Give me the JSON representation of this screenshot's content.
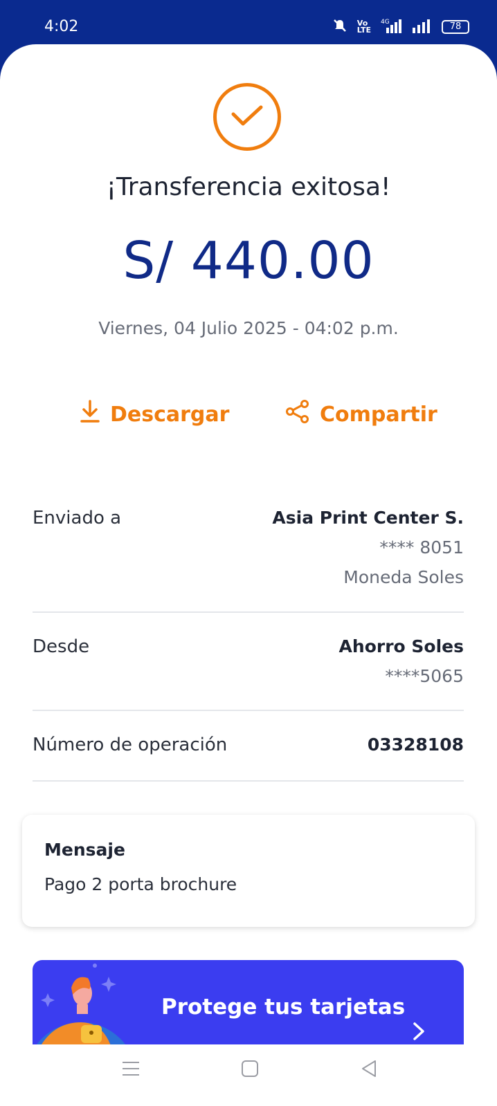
{
  "status_bar": {
    "time": "4:02",
    "battery": "78",
    "icons": [
      "bell-muted-icon",
      "volte-icon",
      "signal-4g-icon",
      "signal-icon",
      "battery-icon"
    ]
  },
  "result": {
    "title": "¡Transferencia exitosa!",
    "amount": "S/ 440.00",
    "date": "Viernes, 04 Julio 2025 - 04:02 p.m."
  },
  "actions": {
    "download_label": "Descargar",
    "share_label": "Compartir"
  },
  "details": {
    "sent_to": {
      "label": "Enviado a",
      "name": "Asia Print Center S.",
      "account": "**** 8051",
      "currency": "Moneda Soles"
    },
    "from": {
      "label": "Desde",
      "name": "Ahorro Soles",
      "account": "****5065"
    },
    "operation": {
      "label": "Número de operación",
      "value": "03328108"
    }
  },
  "message": {
    "title": "Mensaje",
    "text": "Pago 2 porta brochure"
  },
  "banner": {
    "text": "Protege tus tarjetas"
  },
  "colors": {
    "primary_blue": "#0a2a8f",
    "accent_orange": "#f07d0e",
    "banner_blue": "#3b3df0"
  }
}
